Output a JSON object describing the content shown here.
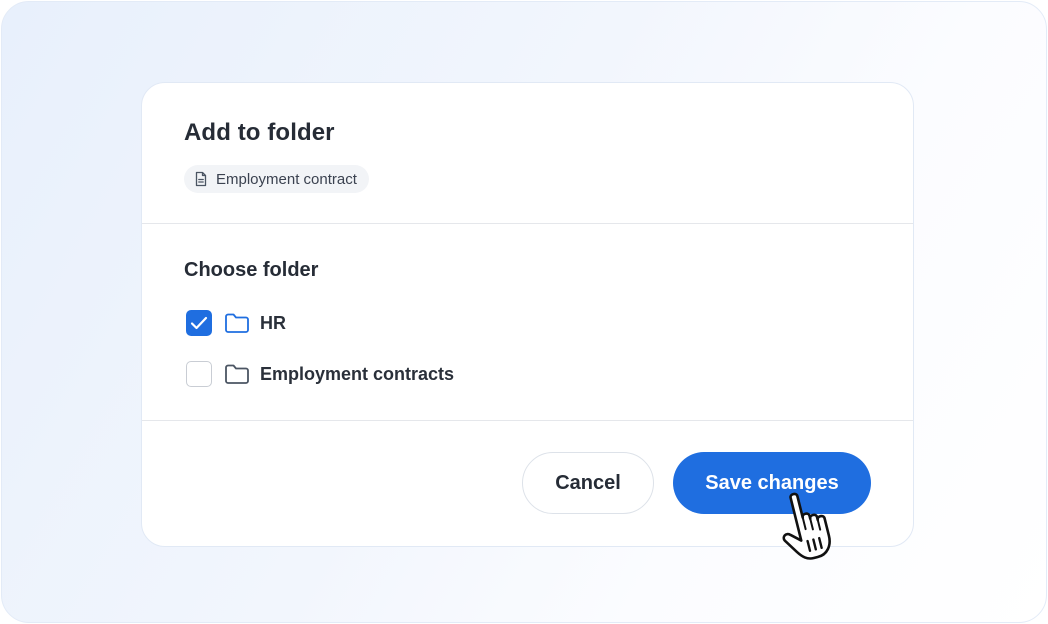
{
  "dialog": {
    "title": "Add to folder",
    "document_chip": {
      "icon": "document-icon",
      "label": "Employment contract"
    }
  },
  "choose_folder": {
    "title": "Choose folder",
    "folders": [
      {
        "label": "HR",
        "checked": true,
        "icon": "folder-icon"
      },
      {
        "label": "Employment contracts",
        "checked": false,
        "icon": "folder-icon"
      }
    ]
  },
  "footer": {
    "cancel_label": "Cancel",
    "save_label": "Save changes"
  },
  "colors": {
    "primary": "#1f6ee0",
    "background_tint": "#e8f0fc",
    "text": "#262c36"
  },
  "cursor": {
    "icon": "hand-pointer-icon"
  }
}
